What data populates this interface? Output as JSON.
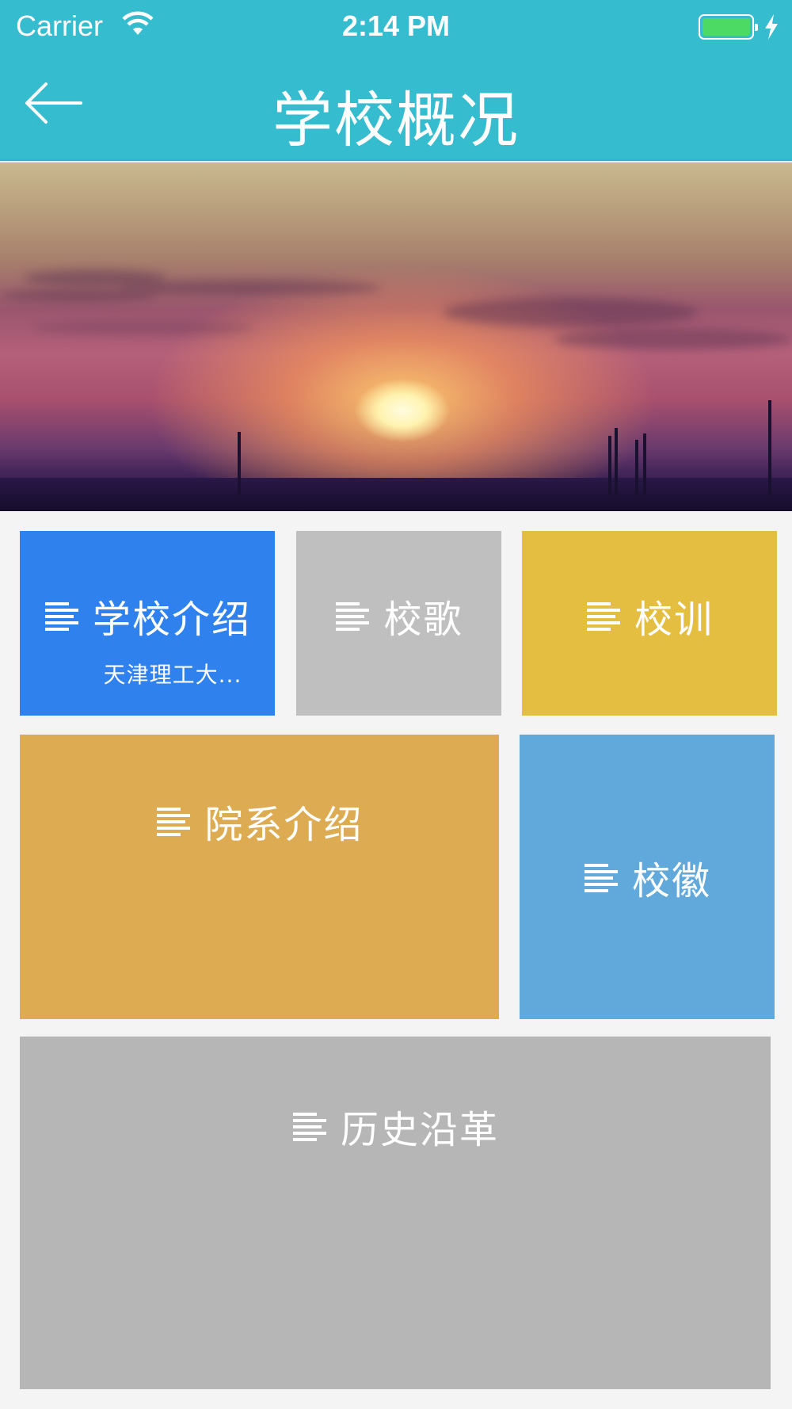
{
  "status_bar": {
    "carrier": "Carrier",
    "time": "2:14 PM",
    "battery_color": "#4cd964"
  },
  "nav": {
    "title": "学校概况",
    "back_icon": "arrow-left-icon",
    "background": "#35bccf"
  },
  "hero": {
    "description_icon": "sunset-banner-image"
  },
  "tiles": [
    {
      "label": "学校介绍",
      "sub": "天津理工大...",
      "color": "#2f82ee",
      "icon": "menu-lines-icon"
    },
    {
      "label": "校歌",
      "color": "#bfbfbf",
      "icon": "menu-lines-icon"
    },
    {
      "label": "校训",
      "color": "#e3be40",
      "icon": "menu-lines-icon"
    },
    {
      "label": "院系介绍",
      "color": "#ddab51",
      "icon": "menu-lines-icon"
    },
    {
      "label": "校徽",
      "color": "#60a9da",
      "icon": "menu-lines-icon"
    },
    {
      "label": "历史沿革",
      "color": "#b6b6b6",
      "icon": "menu-lines-icon"
    }
  ]
}
